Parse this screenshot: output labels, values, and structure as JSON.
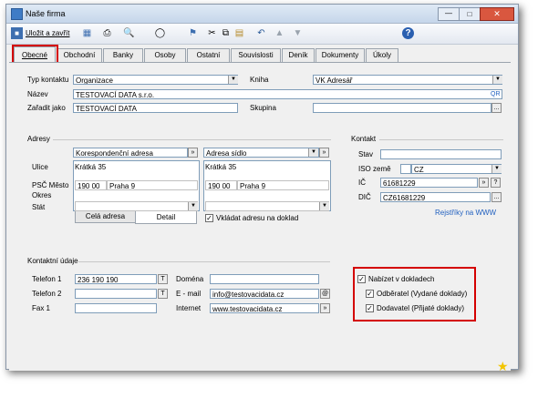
{
  "window": {
    "title": "Naše firma"
  },
  "toolbar": {
    "save_close": "Uložit a zavřít"
  },
  "tabs": [
    "Obecné",
    "Obchodní",
    "Banky",
    "Osoby",
    "Ostatní",
    "Souvislosti",
    "Deník",
    "Dokumenty",
    "Úkoly"
  ],
  "general": {
    "typ_label": "Typ kontaktu",
    "typ_value": "Organizace",
    "kniha_label": "Kniha",
    "kniha_value": "VK Adresář",
    "nazev_label": "Název",
    "nazev_value": "TESTOVACÍ DATA s.r.o.",
    "qr_label": "QR",
    "zaradit_label": "Zařadit jako",
    "zaradit_value": "TESTOVACÍ DATA",
    "skupina_label": "Skupina",
    "skupina_value": ""
  },
  "adresy": {
    "heading": "Adresy",
    "left_type": "Korespondenční adresa",
    "right_type": "Adresa sídlo",
    "ulice_label": "Ulice",
    "psc_label": "PSČ Město",
    "okres_label": "Okres",
    "stat_label": "Stát",
    "left": {
      "ulice": "Krátká 35",
      "psc": "190 00",
      "mesto": "Praha 9"
    },
    "right": {
      "ulice": "Krátká 35",
      "psc": "190 00",
      "mesto": "Praha 9"
    },
    "tab_cela": "Celá adresa",
    "tab_detail": "Detail",
    "vkladat_label": "Vkládat adresu na doklad",
    "vkladat_checked": true
  },
  "kontakt": {
    "heading": "Kontakt",
    "stav_label": "Stav",
    "stav_value": "",
    "iso_label": "ISO země",
    "iso_value": "CZ",
    "ic_label": "IČ",
    "ic_value": "61681229",
    "dic_label": "DIČ",
    "dic_value": "CZ61681229",
    "rejstriky": "Rejstříky na WWW"
  },
  "kontaktni_udaje": {
    "heading": "Kontaktní údaje",
    "telefon1_label": "Telefon 1",
    "telefon1_value": "236 190 190",
    "telefon2_label": "Telefon 2",
    "telefon2_value": "",
    "fax_label": "Fax 1",
    "fax_value": "",
    "domena_label": "Doména",
    "domena_value": "",
    "email_label": "E - mail",
    "email_value": "info@testovacidata.cz",
    "internet_label": "Internet",
    "internet_value": "www.testovacidata.cz"
  },
  "doklady": {
    "nabizet_label": "Nabízet v dokladech",
    "nabizet_checked": true,
    "odberatel_label": "Odběratel (Vydané doklady)",
    "odberatel_checked": true,
    "dodavatel_label": "Dodavatel (Přijaté doklady)",
    "dodavatel_checked": true
  },
  "colors": {
    "highlight": "#d40000",
    "link": "#1f5fbf"
  }
}
